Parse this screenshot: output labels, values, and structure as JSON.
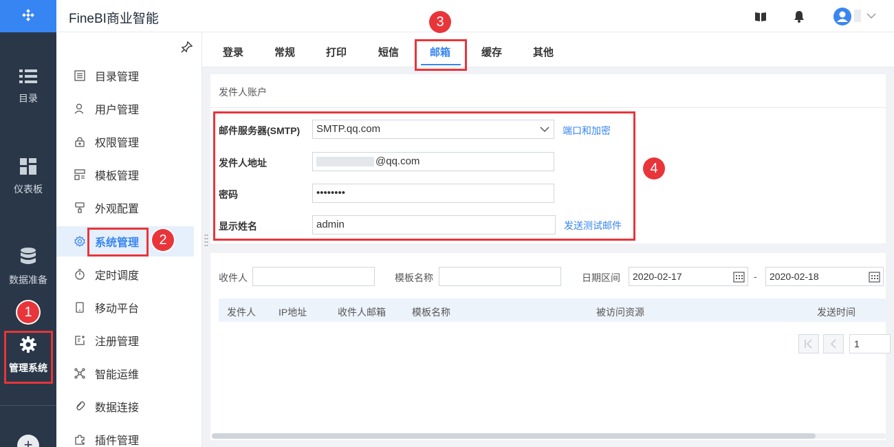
{
  "app": {
    "title": "FineBI商业智能"
  },
  "rail": {
    "items": [
      {
        "label": "目录",
        "icon": "list-icon"
      },
      {
        "label": "仪表板",
        "icon": "dashboard-icon"
      },
      {
        "label": "数据准备",
        "icon": "database-icon"
      },
      {
        "label": "管理系统",
        "icon": "gear-icon",
        "active": true
      }
    ],
    "add_label": "+"
  },
  "sidebar": {
    "items": [
      {
        "label": "目录管理",
        "icon": "catalog-icon"
      },
      {
        "label": "用户管理",
        "icon": "user-icon"
      },
      {
        "label": "权限管理",
        "icon": "lock-icon"
      },
      {
        "label": "模板管理",
        "icon": "template-icon"
      },
      {
        "label": "外观配置",
        "icon": "appearance-icon"
      },
      {
        "label": "系统管理",
        "icon": "system-gear-icon",
        "active": true
      },
      {
        "label": "定时调度",
        "icon": "timer-icon"
      },
      {
        "label": "移动平台",
        "icon": "mobile-icon"
      },
      {
        "label": "注册管理",
        "icon": "register-icon"
      },
      {
        "label": "智能运维",
        "icon": "ops-icon"
      },
      {
        "label": "数据连接",
        "icon": "link-icon"
      },
      {
        "label": "插件管理",
        "icon": "plugin-icon"
      }
    ]
  },
  "tabs": [
    {
      "label": "登录"
    },
    {
      "label": "常规"
    },
    {
      "label": "打印"
    },
    {
      "label": "短信"
    },
    {
      "label": "邮箱",
      "active": true
    },
    {
      "label": "缓存"
    },
    {
      "label": "其他"
    }
  ],
  "sender": {
    "section_title": "发件人账户",
    "smtp_label": "邮件服务器(SMTP)",
    "smtp_value": "SMTP.qq.com",
    "port_link": "端口和加密",
    "address_label": "发件人地址",
    "address_value": "@qq.com",
    "password_label": "密码",
    "password_value": "••••••••",
    "display_name_label": "显示姓名",
    "display_name_value": "admin",
    "test_link": "发送测试邮件"
  },
  "log": {
    "recipient_label": "收件人",
    "template_label": "模板名称",
    "date_label": "日期区间",
    "date_from": "2020-02-17",
    "date_sep": "-",
    "date_to": "2020-02-18",
    "columns": [
      "发件人",
      "IP地址",
      "收件人邮箱",
      "模板名称",
      "被访问资源",
      "发送时间"
    ],
    "page_value": "1"
  },
  "annotations": [
    "1",
    "2",
    "3",
    "4"
  ],
  "colors": {
    "accent": "#3685f2",
    "rail": "#293748",
    "highlight": "#e8353a"
  }
}
